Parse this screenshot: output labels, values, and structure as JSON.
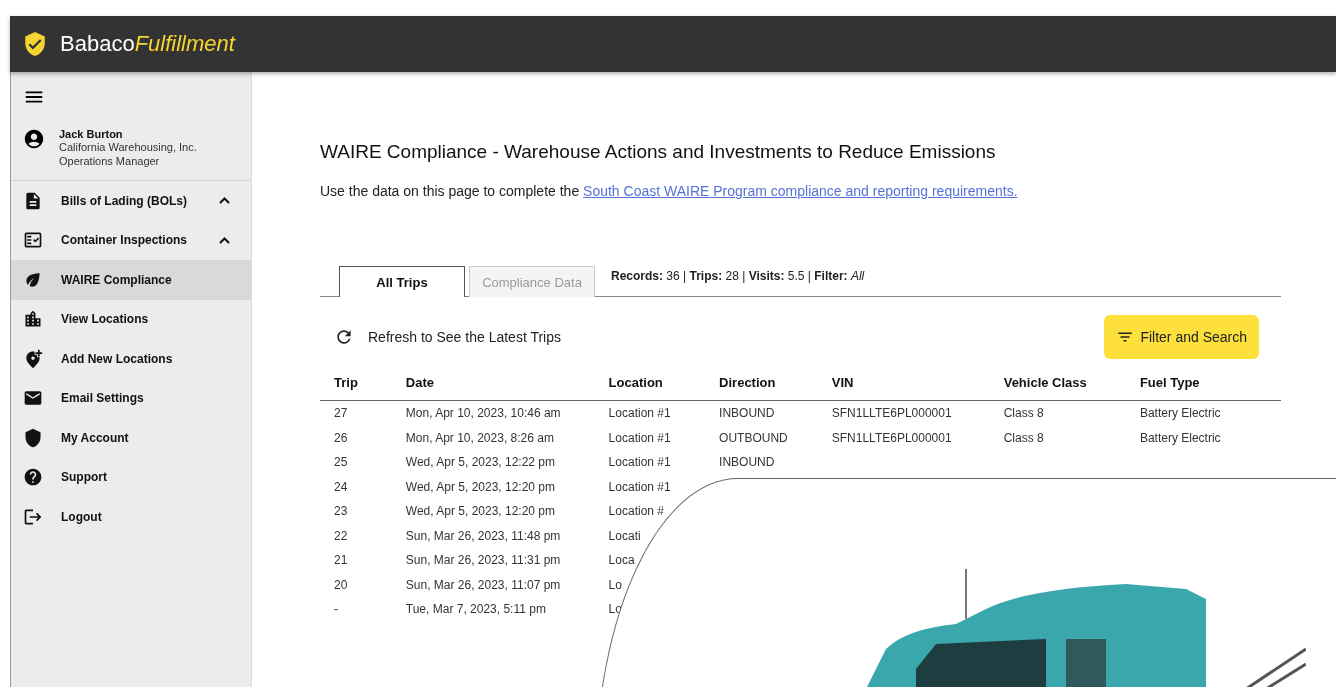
{
  "app": {
    "brand": "Babaco",
    "brand_accent": "Fulfillment"
  },
  "user": {
    "name": "Jack Burton",
    "company": "California Warehousing, Inc.",
    "role": "Operations Manager"
  },
  "sidebar": {
    "items": [
      {
        "label": "Bills of Lading (BOLs)",
        "expandable": true,
        "selected": false
      },
      {
        "label": "Container Inspections",
        "expandable": true,
        "selected": false
      },
      {
        "label": "WAIRE Compliance",
        "expandable": false,
        "selected": true
      },
      {
        "label": "View Locations",
        "expandable": false,
        "selected": false
      },
      {
        "label": "Add New Locations",
        "expandable": false,
        "selected": false
      },
      {
        "label": "Email Settings",
        "expandable": false,
        "selected": false
      },
      {
        "label": "My Account",
        "expandable": false,
        "selected": false
      },
      {
        "label": "Support",
        "expandable": false,
        "selected": false
      },
      {
        "label": "Logout",
        "expandable": false,
        "selected": false
      }
    ]
  },
  "page": {
    "title": "WAIRE Compliance - Warehouse Actions and Investments to Reduce Emissions",
    "intro": "Use the data on this page to complete the",
    "link": "South Coast WAIRE Program compliance and reporting requirements."
  },
  "tabs": [
    {
      "label": "All Trips",
      "selected": true
    },
    {
      "label": "Compliance Data",
      "selected": false
    }
  ],
  "summary": "**Records:** 36 | **Trips:** 28 | **Visits:** 5.5 | **Filter:** *All*",
  "refresh": "Refresh to See the Latest Trips",
  "filter_button": "Filter and Search",
  "table": {
    "columns": [
      "Trip",
      "Date",
      "Location",
      "Direction",
      "VIN",
      "Vehicle Class",
      "Fuel Type"
    ],
    "rows": [
      [
        "27",
        "Mon, Apr 10, 2023, 10:46 am",
        "Location #1",
        "INBOUND",
        "SFN1LLTE6PL000001",
        "Class 8",
        "Battery Electric"
      ],
      [
        "26",
        "Mon, Apr 10, 2023, 8:26 am",
        "Location #1",
        "OUTBOUND",
        "SFN1LLTE6PL000001",
        "Class 8",
        "Battery Electric"
      ],
      [
        "25",
        "Wed, Apr 5, 2023, 12:22 pm",
        "Location #1",
        "INBOUND"
      ],
      [
        "24",
        "Wed, Apr 5, 2023, 12:20 pm",
        "Location #1"
      ],
      [
        "23",
        "Wed, Apr 5, 2023, 12:20 pm",
        "Location #"
      ],
      [
        "22",
        "Sun, Mar 26, 2023, 11:48 pm",
        "Locati"
      ],
      [
        "21",
        "Sun, Mar 26, 2023, 11:31 pm",
        "Loca"
      ],
      [
        "20",
        "Sun, Mar 26, 2023, 11:07 pm",
        "Lo"
      ],
      [
        "-",
        "Tue, Mar 7, 2023, 5:11 pm",
        "Lo"
      ]
    ]
  }
}
